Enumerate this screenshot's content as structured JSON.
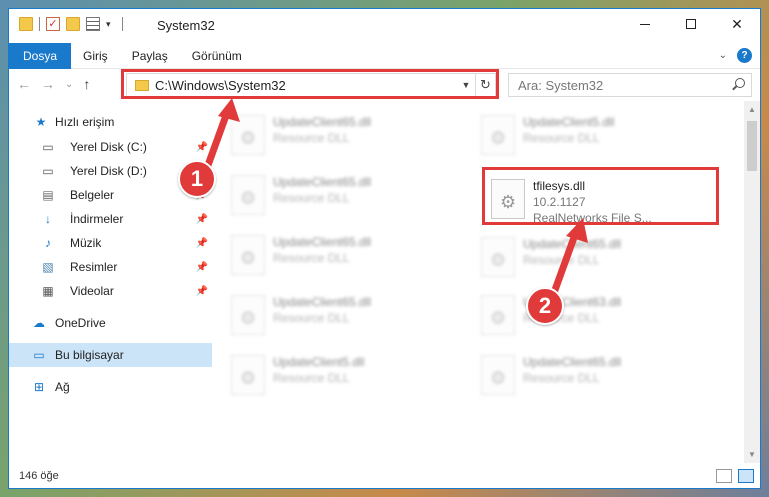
{
  "window": {
    "title": "System32",
    "controls": {
      "minimize": "",
      "maximize": "",
      "close": "✕"
    }
  },
  "ribbon": {
    "tabs": [
      "Dosya",
      "Giriş",
      "Paylaş",
      "Görünüm"
    ],
    "help": "?"
  },
  "nav": {
    "back": "←",
    "forward": "→",
    "recent": "⌄",
    "up": "↑",
    "address": "C:\\Windows\\System32",
    "search_placeholder": "Ara: System32"
  },
  "sidebar": {
    "items": [
      {
        "label": "Hızlı erişim",
        "icon": "star-icon",
        "pinned": false
      },
      {
        "label": "Yerel Disk (C:)",
        "icon": "drive-icon",
        "pinned": true
      },
      {
        "label": "Yerel Disk (D:)",
        "icon": "drive-icon",
        "pinned": true
      },
      {
        "label": "Belgeler",
        "icon": "documents-icon",
        "pinned": true
      },
      {
        "label": "İndirmeler",
        "icon": "downloads-icon",
        "pinned": true
      },
      {
        "label": "Müzik",
        "icon": "music-icon",
        "pinned": true
      },
      {
        "label": "Resimler",
        "icon": "pictures-icon",
        "pinned": true
      },
      {
        "label": "Videolar",
        "icon": "videos-icon",
        "pinned": true
      },
      {
        "label": "OneDrive",
        "icon": "cloud-icon",
        "pinned": false
      },
      {
        "label": "Bu bilgisayar",
        "icon": "computer-icon",
        "pinned": false,
        "selected": true
      },
      {
        "label": "Ağ",
        "icon": "network-icon",
        "pinned": false
      }
    ]
  },
  "files": {
    "highlighted": {
      "name": "tfilesys.dll",
      "version": "10.2.1127",
      "description": "RealNetworks File S..."
    },
    "blurred": [
      {
        "name": "UpdateClient65.dll",
        "type": "Resource DLL"
      },
      {
        "name": "UpdateClient5.dll",
        "type": "Resource DLL"
      },
      {
        "name": "UpdateClient65.dll",
        "type": "Resource DLL"
      },
      {
        "name": "UpdateClient65.dll",
        "type": "Resource DLL"
      },
      {
        "name": "UpdateClient65.dll",
        "type": "Resource DLL"
      },
      {
        "name": "UpdateClient65.dll",
        "type": "Resource DLL"
      },
      {
        "name": "UpdateClient65.dll",
        "type": "Resource DLL"
      },
      {
        "name": "UpdateClient63.dll",
        "type": "Resource DLL"
      },
      {
        "name": "UpdateClient5.dll",
        "type": "Resource DLL"
      },
      {
        "name": "UpdateClient65.dll",
        "type": "Resource DLL"
      }
    ]
  },
  "status": {
    "item_count": "146 öğe"
  },
  "annotations": {
    "marker1": "1",
    "marker2": "2",
    "color": "#e03a3a"
  },
  "colors": {
    "accent": "#1979ca",
    "selected": "#cce4f7"
  }
}
